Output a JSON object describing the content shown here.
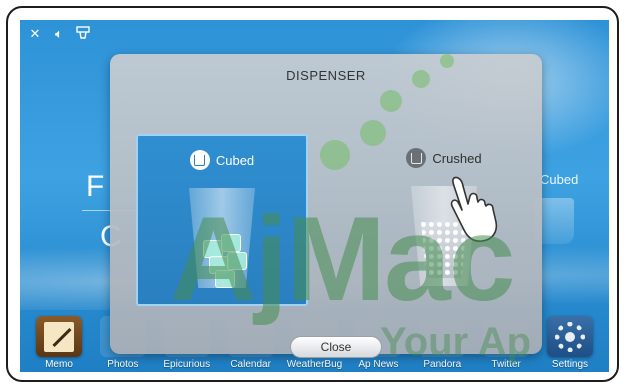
{
  "status_icons": [
    "close-icon",
    "speaker-icon",
    "dispenser-icon"
  ],
  "background": {
    "left_text_top": "F",
    "left_text_bottom": "C",
    "right_option_label": "Cubed"
  },
  "dialog": {
    "title": "DISPENSER",
    "options": [
      {
        "label": "Cubed",
        "icon": "cup-icon",
        "selected": true
      },
      {
        "label": "Crushed",
        "icon": "cup-icon",
        "selected": false
      }
    ],
    "close_label": "Close"
  },
  "dock": {
    "items": [
      {
        "label": "Memo"
      },
      {
        "label": "Photos"
      },
      {
        "label": "Epicurious"
      },
      {
        "label": "Calendar"
      },
      {
        "label": "WeatherBug"
      },
      {
        "label": "Ap News"
      },
      {
        "label": "Pandora"
      },
      {
        "label": "Twitter"
      },
      {
        "label": "Settings"
      }
    ]
  },
  "watermark": {
    "main": "AjMac",
    "sub": "Your Ap"
  },
  "colors": {
    "screen_bg": "#2e92d7",
    "selected_option": "#2f8fd1",
    "dialog_bg": "#c8cdd2"
  }
}
